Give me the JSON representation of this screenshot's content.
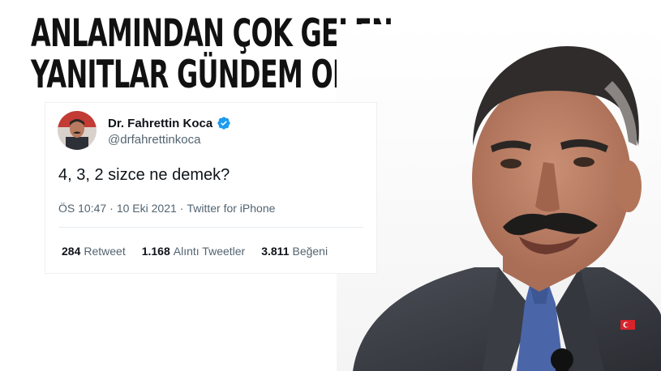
{
  "headline": {
    "line1": "ANLAMINDAN ÇOK GELEN",
    "line2": "YANITLAR GÜNDEM OLDU"
  },
  "tweet": {
    "author_name": "Dr. Fahrettin Koca",
    "handle": "@drfahrettinkoca",
    "text": "4, 3, 2 sizce ne demek?",
    "time": "ÖS 10:47",
    "date": "10 Eki 2021",
    "source": "Twitter for iPhone",
    "separator": "·",
    "stats": {
      "retweets": "284",
      "retweets_label": "Retweet",
      "quotes": "1.168",
      "quotes_label": "Alıntı Tweetler",
      "likes": "3.811",
      "likes_label": "Beğeni"
    }
  },
  "colors": {
    "headline": "#111111",
    "verified_badge": "#1d9bf0",
    "muted_text": "#536471",
    "primary_text": "#0f1419",
    "suit": "#3a3d44",
    "tie": "#4a66a8"
  },
  "icons": {
    "verified": "verified-badge-icon",
    "flag_pin": "turkish-flag-pin-icon"
  }
}
